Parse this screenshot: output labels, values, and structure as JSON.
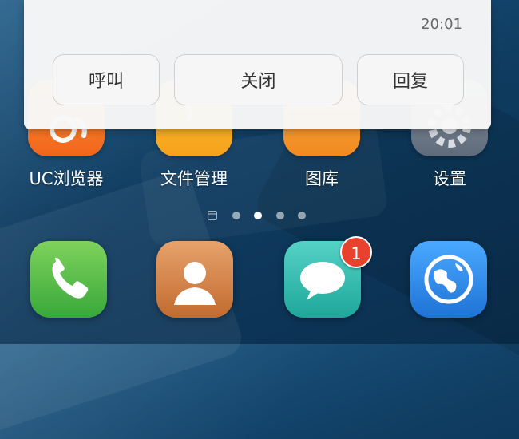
{
  "notification": {
    "time": "20:01",
    "actions": {
      "call": "呼叫",
      "close": "关闭",
      "reply": "回复"
    }
  },
  "apps": {
    "uc_browser": "UC浏览器",
    "file_manager": "文件管理",
    "gallery": "图库",
    "settings": "设置"
  },
  "dock": {
    "messages_badge": "1"
  },
  "pager": {
    "active_page": 2,
    "page_count": 4
  },
  "colors": {
    "badge": "#e8422f",
    "phone": "#38a83a",
    "contacts": "#c26b2f",
    "messages": "#1ea79a",
    "browser": "#1f73d6"
  }
}
